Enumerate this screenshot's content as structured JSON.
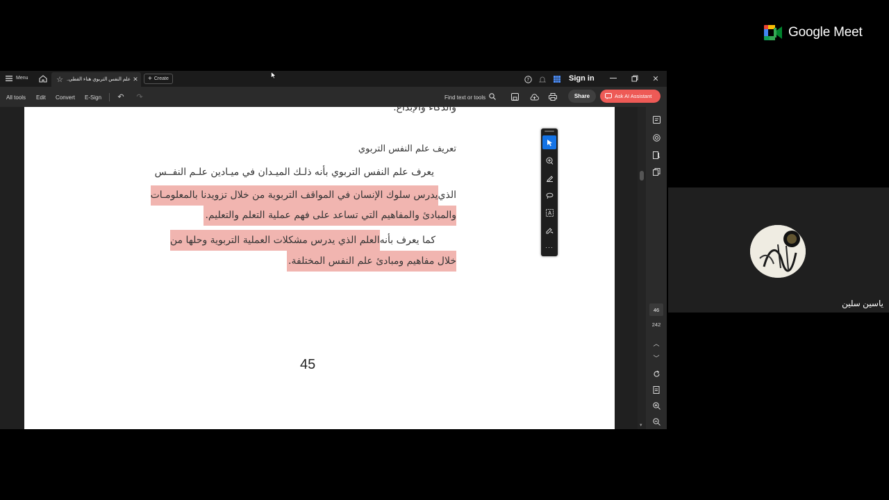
{
  "meet": {
    "brand": "Google Meet",
    "participant_name": "ياسين سلين",
    "avatar_text": "ياسين"
  },
  "tabbar": {
    "menu_label": "Menu",
    "tab_title": "علم النفس التربوي هناء القطي..",
    "create_label": "Create",
    "sign_in_label": "Sign in"
  },
  "toolbar": {
    "items": [
      "All tools",
      "Edit",
      "Convert",
      "E-Sign"
    ],
    "find_label": "Find text or tools",
    "share_label": "Share",
    "ai_label": "Ask AI Assistant"
  },
  "document": {
    "top_cut_text": "والذكاء والإبداع.",
    "heading": "تعريف علم النفس التربوي",
    "para1_line1": "يعرف علم النفس التربوي بأنه ذلـك الميـدان في ميـادين علـم النفــس",
    "para1_line2_plain": "الذي",
    "para1_line2_hl": " يدرس سلوك الإنسان في المواقف التربوية من خلال تزويدنا بالمعلومـات",
    "para1_line3": "والمبادئ والمفاهيم التي تساعد على فهم عملية التعلم والتعليم.",
    "para2_line1_plain": "كما يعرف بأنه",
    "para2_line1_hl": " العلم الذي يدرس مشكلات العملية التربوية وحلها من",
    "para2_line2": "خلال مفاهيم ومبادئ علم النفس المختلفة.",
    "page_number_printed": "45"
  },
  "rail": {
    "current_page": "46",
    "total_pages": "242"
  },
  "colors": {
    "highlight": "#f1b5b0",
    "share_bg": "#3f3f3f",
    "ai_bg": "#ee5a56",
    "select_tool": "#1473e6"
  }
}
